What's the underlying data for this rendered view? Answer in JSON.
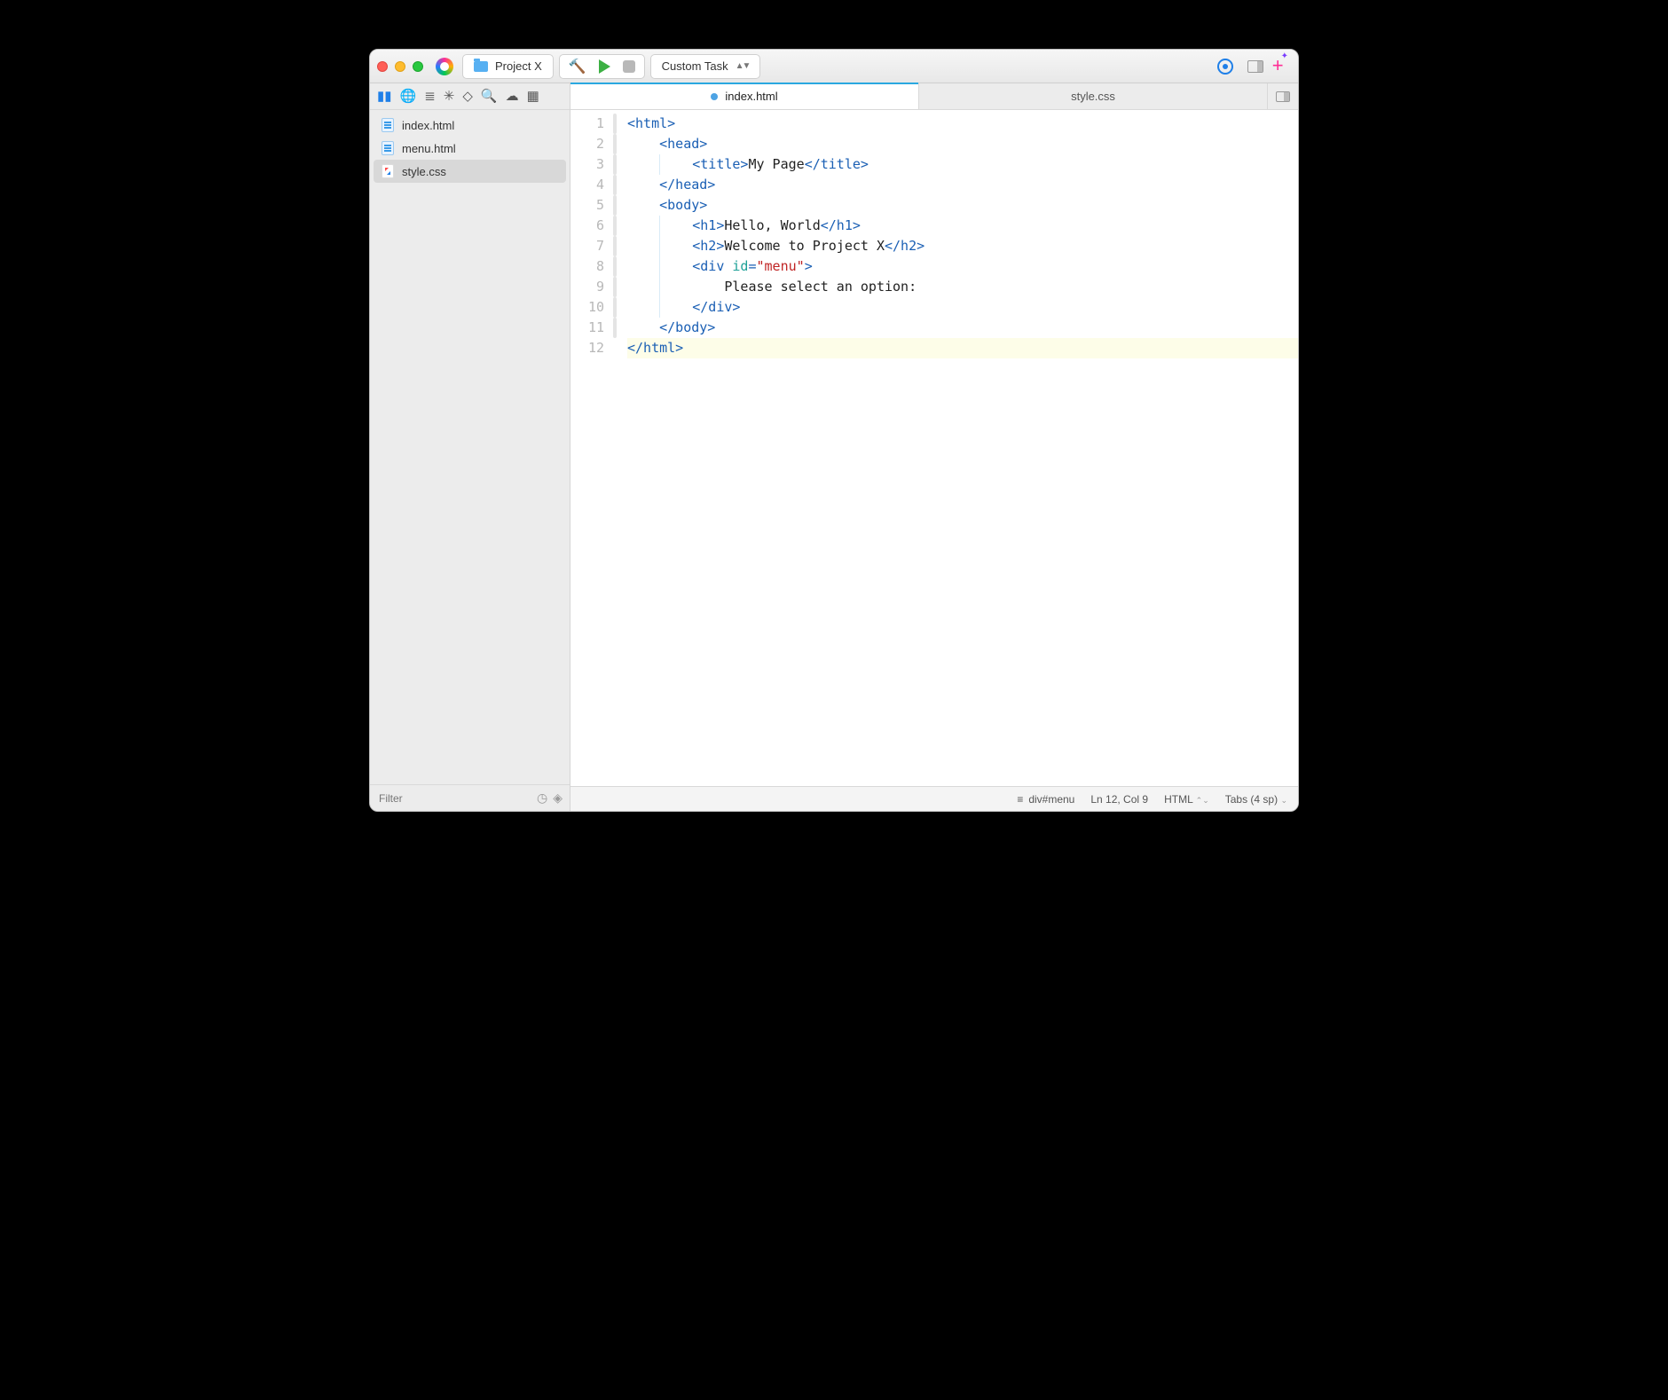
{
  "titlebar": {
    "project_name": "Project X",
    "task_name": "Custom Task"
  },
  "sidebar": {
    "files": [
      {
        "name": "index.html",
        "icon": "html",
        "selected": false
      },
      {
        "name": "menu.html",
        "icon": "html",
        "selected": false
      },
      {
        "name": "style.css",
        "icon": "css",
        "selected": true
      }
    ],
    "filter_placeholder": "Filter"
  },
  "tabs": [
    {
      "label": "index.html",
      "active": true,
      "modified": true
    },
    {
      "label": "style.css",
      "active": false,
      "modified": false
    }
  ],
  "editor": {
    "lines": [
      {
        "n": 1,
        "indent": 0,
        "html": "<span class='t-tag'>&lt;html&gt;</span>"
      },
      {
        "n": 2,
        "indent": 1,
        "html": "<span class='t-tag'>&lt;head&gt;</span>"
      },
      {
        "n": 3,
        "indent": 2,
        "guide": true,
        "html": "<span class='t-tag'>&lt;title&gt;</span><span class='t-txt'>My Page</span><span class='t-tag'>&lt;/title&gt;</span>"
      },
      {
        "n": 4,
        "indent": 1,
        "html": "<span class='t-tag'>&lt;/head&gt;</span>"
      },
      {
        "n": 5,
        "indent": 1,
        "html": "<span class='t-tag'>&lt;body&gt;</span>"
      },
      {
        "n": 6,
        "indent": 2,
        "guide": true,
        "html": "<span class='t-tag'>&lt;h1&gt;</span><span class='t-txt'>Hello, World</span><span class='t-tag'>&lt;/h1&gt;</span>"
      },
      {
        "n": 7,
        "indent": 2,
        "guide": true,
        "html": "<span class='t-tag'>&lt;h2&gt;</span><span class='t-txt'>Welcome to Project X</span><span class='t-tag'>&lt;/h2&gt;</span>"
      },
      {
        "n": 8,
        "indent": 2,
        "guide": true,
        "html": "<span class='t-tag'>&lt;div </span><span class='t-attr'>id</span><span class='t-tag'>=</span><span class='t-str'>\"menu\"</span><span class='t-tag'>&gt;</span>"
      },
      {
        "n": 9,
        "indent": 3,
        "guide": true,
        "html": "<span class='t-txt'>Please select an option:</span>"
      },
      {
        "n": 10,
        "indent": 2,
        "guide": true,
        "html": "<span class='t-tag'>&lt;/div&gt;</span>"
      },
      {
        "n": 11,
        "indent": 1,
        "html": "<span class='t-tag'>&lt;/body&gt;</span>"
      },
      {
        "n": 12,
        "indent": 0,
        "hl": true,
        "html": "<span class='t-tag'>&lt;/html&gt;</span>"
      }
    ],
    "fold_regions": [
      {
        "start": 1,
        "end": 4
      },
      {
        "start": 5,
        "end": 11
      }
    ]
  },
  "status": {
    "breadcrumb": "div#menu",
    "position": "Ln 12, Col 9",
    "language": "HTML",
    "indent": "Tabs (4 sp)"
  }
}
